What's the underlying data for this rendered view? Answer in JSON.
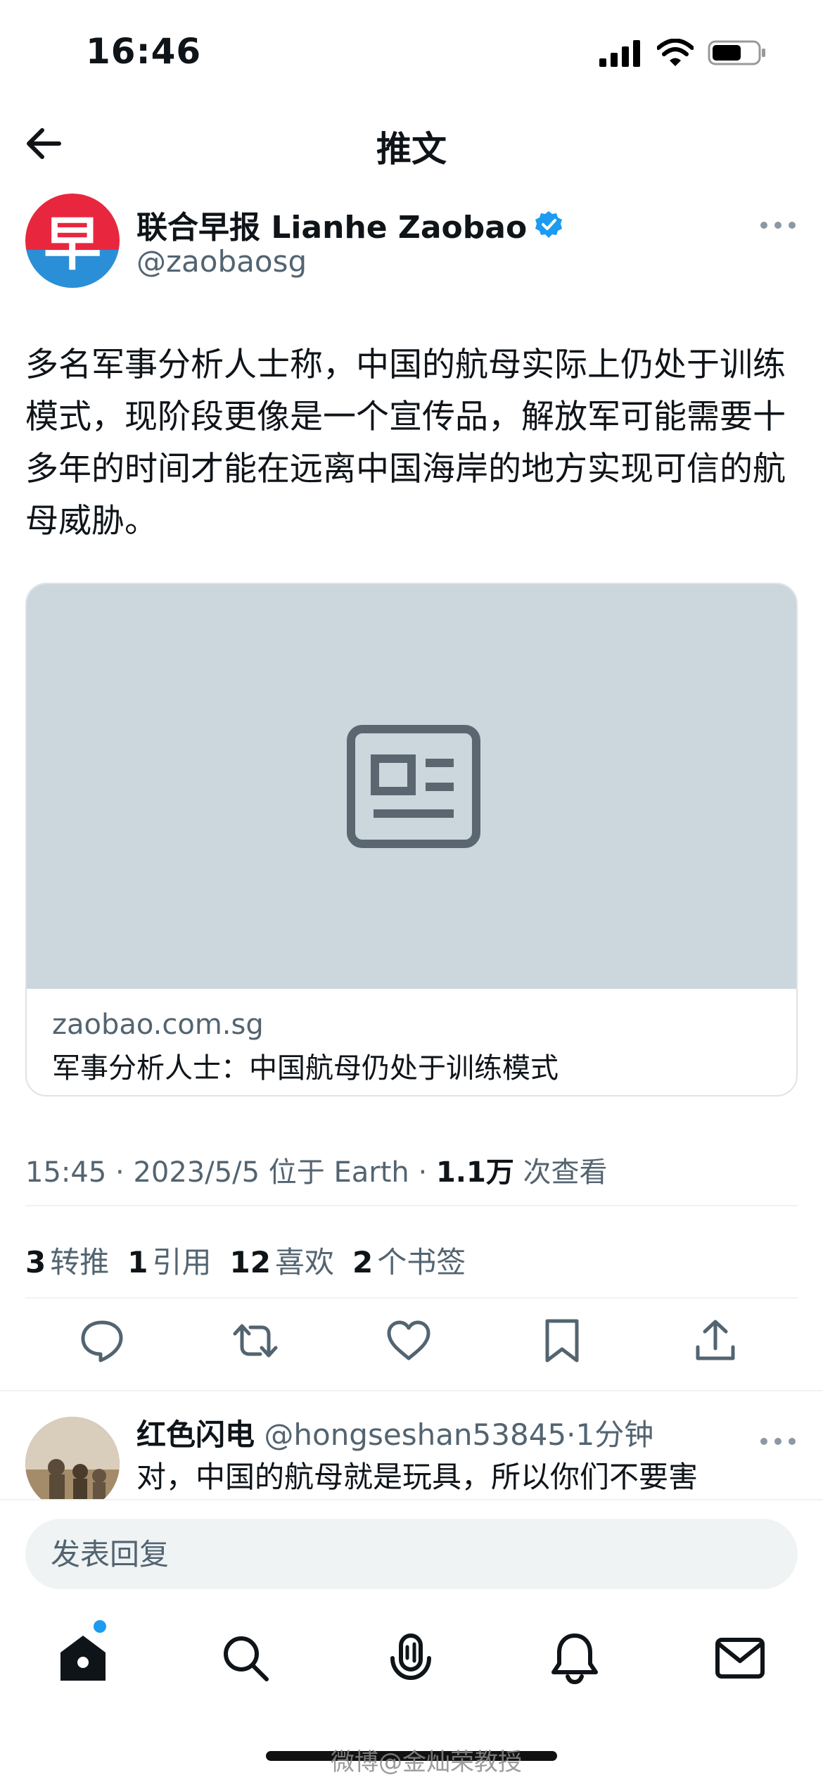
{
  "status_bar": {
    "time": "16:46",
    "icons": [
      "signal-icon",
      "wifi-icon",
      "battery-icon"
    ]
  },
  "topbar": {
    "back_icon": "arrow-left-icon",
    "title": "推文"
  },
  "author": {
    "name": "联合早报 Lianhe Zaobao",
    "handle": "@zaobaosg",
    "verified": true,
    "avatar_char": "早"
  },
  "tweet": {
    "text": "多名军事分析人士称，中国的航母实际上仍处于训练模式，现阶段更像是一个宣传品，解放军可能需要十多年的时间才能在远离中国海岸的地方实现可信的航母威胁。"
  },
  "card": {
    "domain": "zaobao.com.sg",
    "title": "军事分析人士：中国航母仍处于训练模式"
  },
  "meta": {
    "time": "15:45",
    "sep1": " · ",
    "date": "2023/5/5",
    "location": " 位于 Earth",
    "sep2": " · ",
    "views": "1.1万",
    "views_label": " 次查看"
  },
  "stats": [
    {
      "count": "3",
      "label": "转推"
    },
    {
      "count": "1",
      "label": "引用"
    },
    {
      "count": "12",
      "label": "喜欢"
    },
    {
      "count": "2",
      "label": "个书签"
    }
  ],
  "reply": {
    "name": "红色闪电",
    "handle": "@hongseshan53845",
    "time": "·1分钟",
    "text": "对，中国的航母就是玩具，所以你们不要害"
  },
  "compose": {
    "placeholder": "发表回复"
  },
  "watermark": "微博@金灿荣教授",
  "colors": {
    "accent": "#1d9bf0",
    "text": "#0f1419",
    "secondary": "#536471",
    "card_bg": "#ccd6dd"
  }
}
